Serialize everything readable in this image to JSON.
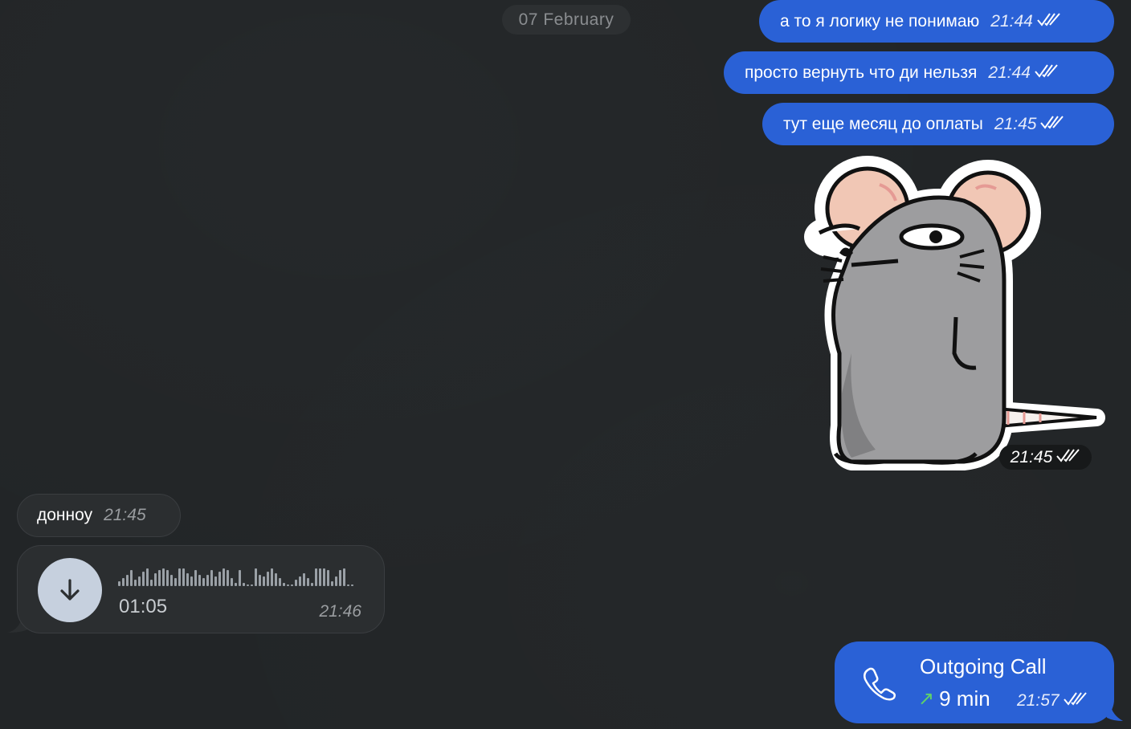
{
  "date_separator": "07 February",
  "outgoing_messages": [
    {
      "text": "а то я логику не понимаю",
      "time": "21:44"
    },
    {
      "text": "просто вернуть что ди нельзя",
      "time": "21:44"
    },
    {
      "text": "тут еще месяц до оплаты",
      "time": "21:45"
    }
  ],
  "sticker": {
    "icon": "rat-sticker",
    "time": "21:45"
  },
  "incoming_text": {
    "text": "донноу",
    "time": "21:45"
  },
  "voice_message": {
    "duration": "01:05",
    "time": "21:46",
    "icon": "download-arrow-icon"
  },
  "outgoing_call": {
    "title": "Outgoing Call",
    "duration": "9 min",
    "time": "21:57",
    "icon": "phone-icon"
  },
  "colors": {
    "background": "#222527",
    "outgoing_bubble": "#2a61d6",
    "incoming_bubble": "#2b2e30",
    "call_arrow": "#5fd16a"
  }
}
